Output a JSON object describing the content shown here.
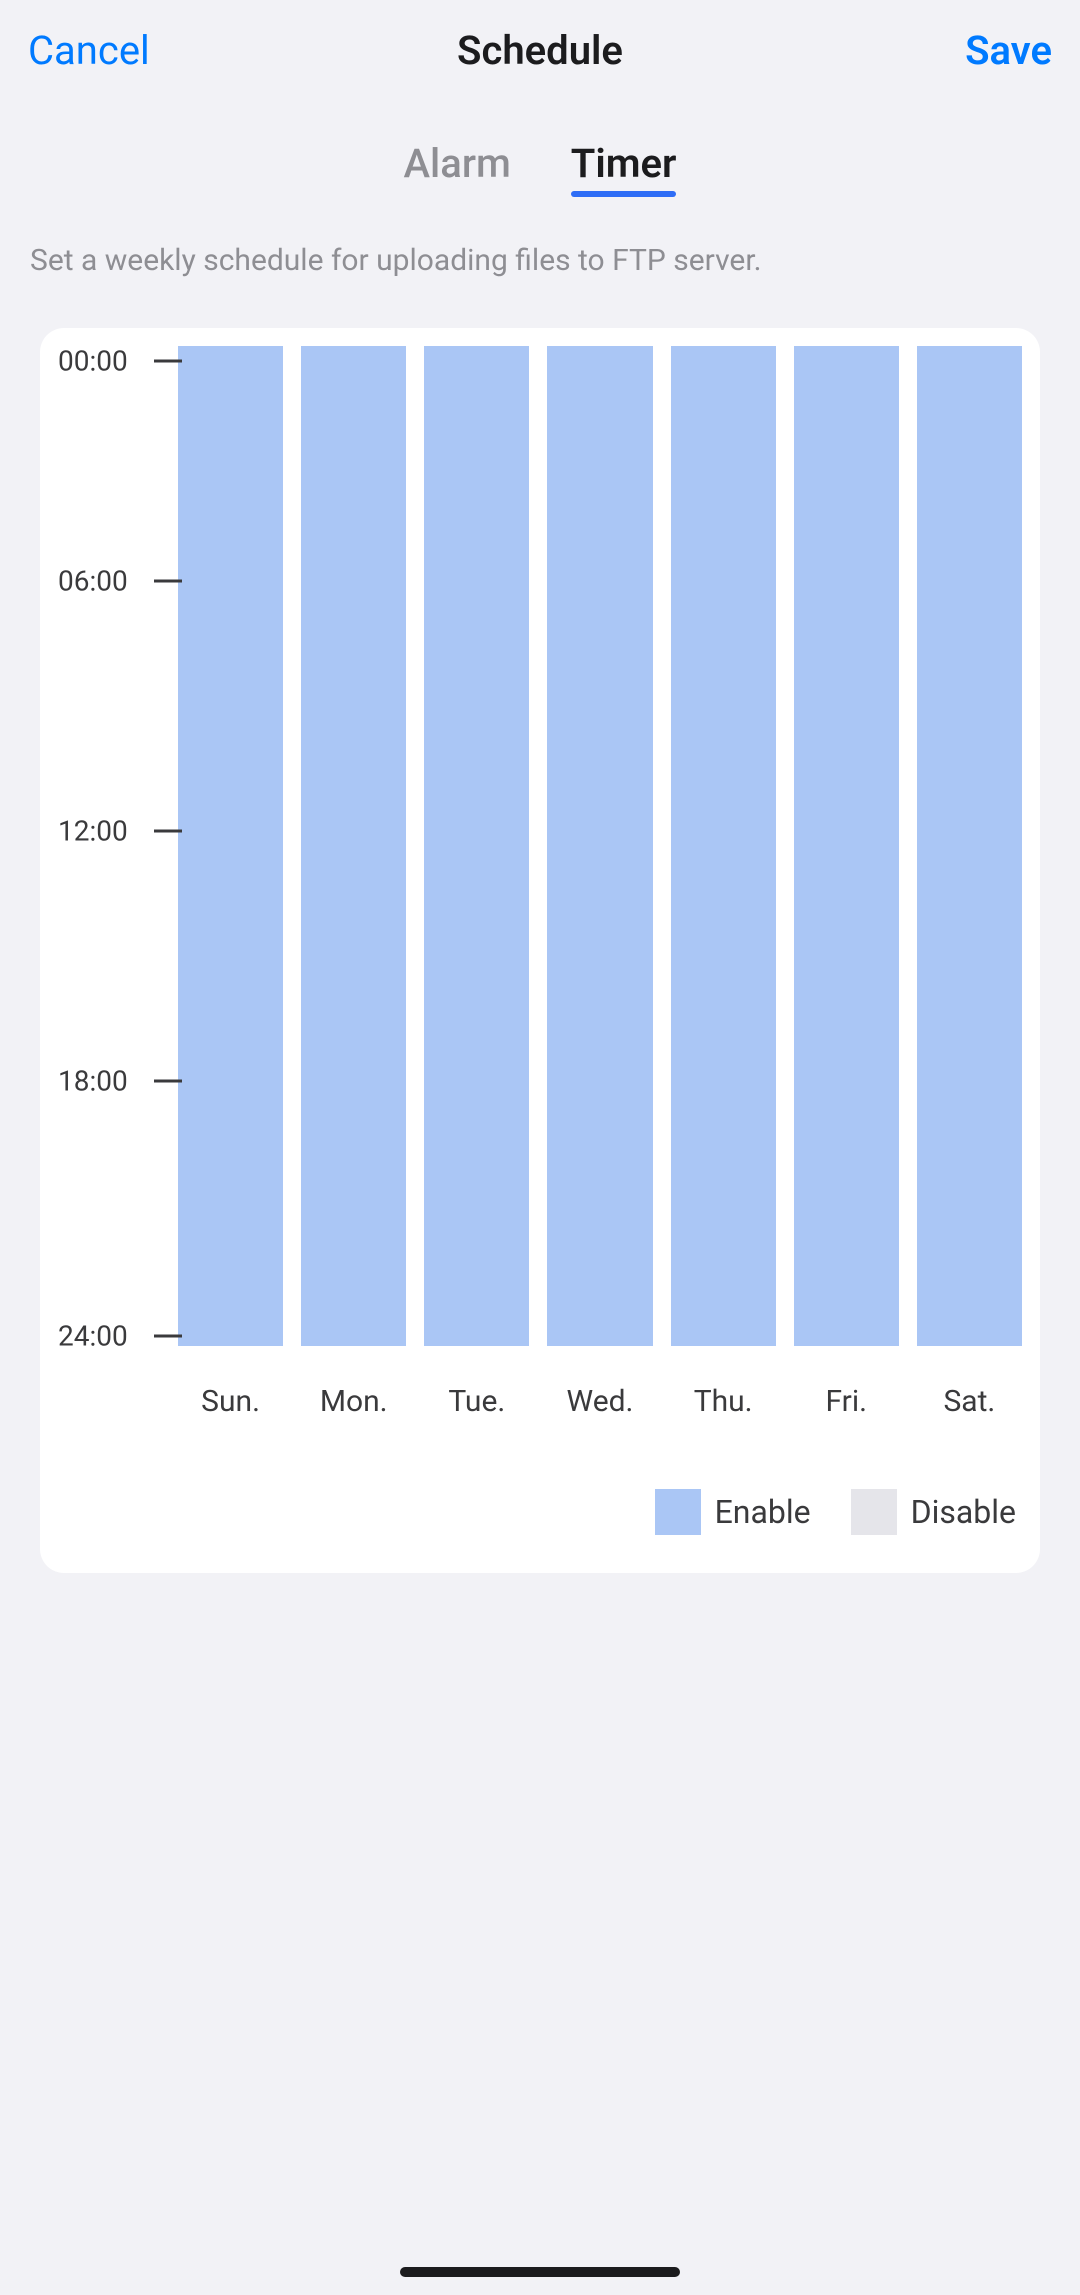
{
  "header": {
    "cancel": "Cancel",
    "title": "Schedule",
    "save": "Save"
  },
  "tabs": {
    "alarm": "Alarm",
    "timer": "Timer",
    "active": "timer"
  },
  "description": "Set a weekly schedule for uploading files to FTP server.",
  "schedule": {
    "time_ticks": [
      "00:00",
      "06:00",
      "12:00",
      "18:00",
      "24:00"
    ],
    "days": [
      "Sun.",
      "Mon.",
      "Tue.",
      "Wed.",
      "Thu.",
      "Fri.",
      "Sat."
    ]
  },
  "legend": {
    "enable": "Enable",
    "disable": "Disable"
  },
  "chart_data": {
    "type": "bar",
    "title": "",
    "xlabel": "",
    "ylabel": "",
    "ylim": [
      0,
      24
    ],
    "categories": [
      "Sun.",
      "Mon.",
      "Tue.",
      "Wed.",
      "Thu.",
      "Fri.",
      "Sat."
    ],
    "series": [
      {
        "name": "Enable",
        "values": [
          [
            0,
            24
          ],
          [
            0,
            24
          ],
          [
            0,
            24
          ],
          [
            0,
            24
          ],
          [
            0,
            24
          ],
          [
            0,
            24
          ],
          [
            0,
            24
          ]
        ]
      }
    ],
    "y_ticks": [
      0,
      6,
      12,
      18,
      24
    ],
    "y_tick_labels": [
      "00:00",
      "06:00",
      "12:00",
      "18:00",
      "24:00"
    ],
    "legend": [
      "Enable",
      "Disable"
    ]
  }
}
